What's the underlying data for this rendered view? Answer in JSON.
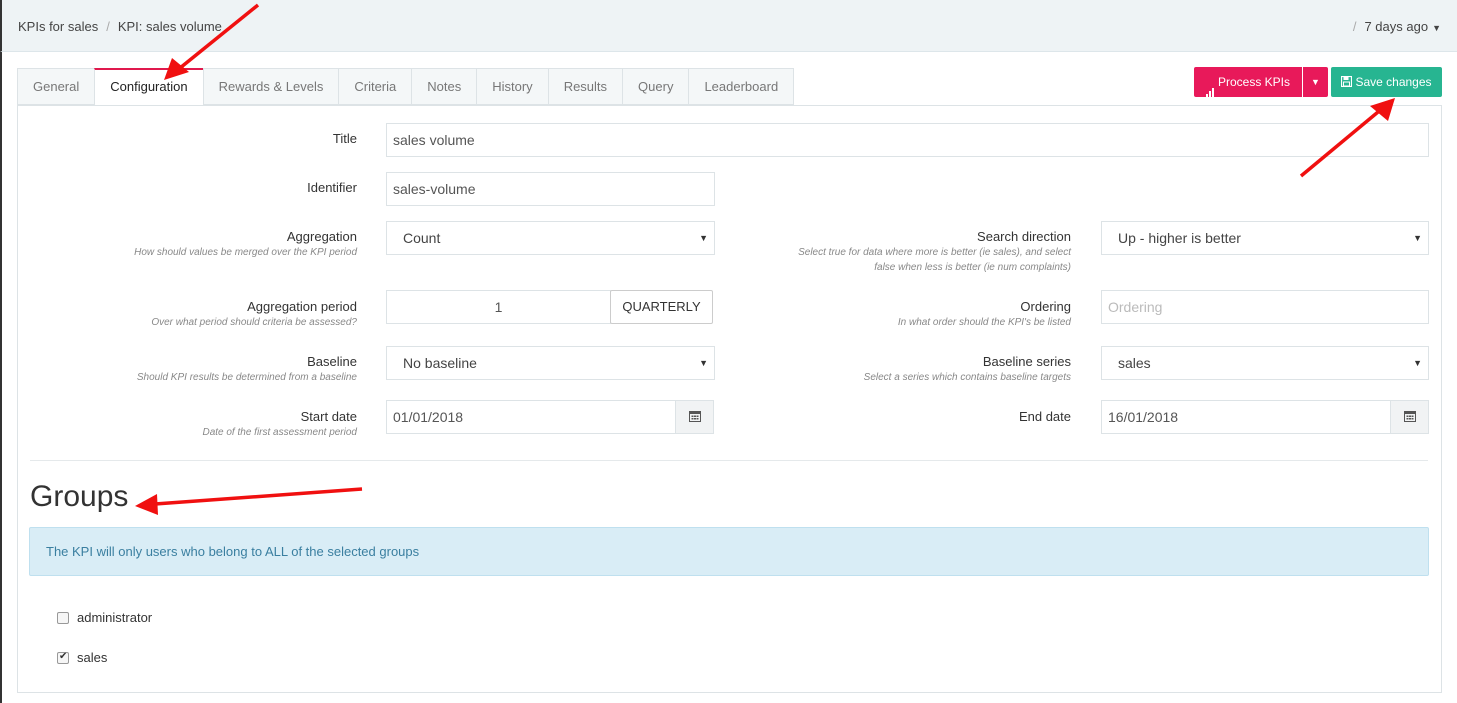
{
  "breadcrumb": {
    "parent": "KPIs for sales",
    "separator": "/",
    "current": "KPI: sales volume"
  },
  "updated": {
    "separator": "/",
    "text": "7 days ago"
  },
  "tabs": [
    {
      "label": "General"
    },
    {
      "label": "Configuration"
    },
    {
      "label": "Rewards & Levels"
    },
    {
      "label": "Criteria"
    },
    {
      "label": "Notes"
    },
    {
      "label": "History"
    },
    {
      "label": "Results"
    },
    {
      "label": "Query"
    },
    {
      "label": "Leaderboard"
    }
  ],
  "active_tab": "Configuration",
  "actions": {
    "process_label": "Process KPIs",
    "save_label": "Save changes"
  },
  "form": {
    "title": {
      "label": "Title",
      "value": "sales volume"
    },
    "identifier": {
      "label": "Identifier",
      "value": "sales-volume"
    },
    "aggregation": {
      "label": "Aggregation",
      "help": "How should values be merged over the KPI period",
      "value": "Count"
    },
    "search_direction": {
      "label": "Search direction",
      "help_line1": "Select true for data where more is better (ie sales), and select",
      "help_line2": "false when less is better (ie num complaints)",
      "value": "Up - higher is better"
    },
    "aggregation_period": {
      "label": "Aggregation period",
      "help": "Over what period should criteria be assessed?",
      "value": "1",
      "unit": "QUARTERLY"
    },
    "ordering": {
      "label": "Ordering",
      "help": "In what order should the KPI's be listed",
      "placeholder": "Ordering"
    },
    "baseline": {
      "label": "Baseline",
      "help": "Should KPI results be determined from a baseline",
      "value": "No baseline"
    },
    "baseline_series": {
      "label": "Baseline series",
      "help": "Select a series which contains baseline targets",
      "value": "sales"
    },
    "start_date": {
      "label": "Start date",
      "help": "Date of the first assessment period",
      "value": "01/01/2018"
    },
    "end_date": {
      "label": "End date",
      "value": "16/01/2018"
    }
  },
  "groups": {
    "heading": "Groups",
    "info": "The KPI will only users who belong to ALL of the selected groups",
    "items": [
      {
        "label": "administrator",
        "checked": false
      },
      {
        "label": "sales",
        "checked": true
      }
    ]
  },
  "colors": {
    "accent_pink": "#e8195a",
    "save_green": "#27b591",
    "annotation_red": "#f01010",
    "info_bg": "#d9edf6"
  }
}
